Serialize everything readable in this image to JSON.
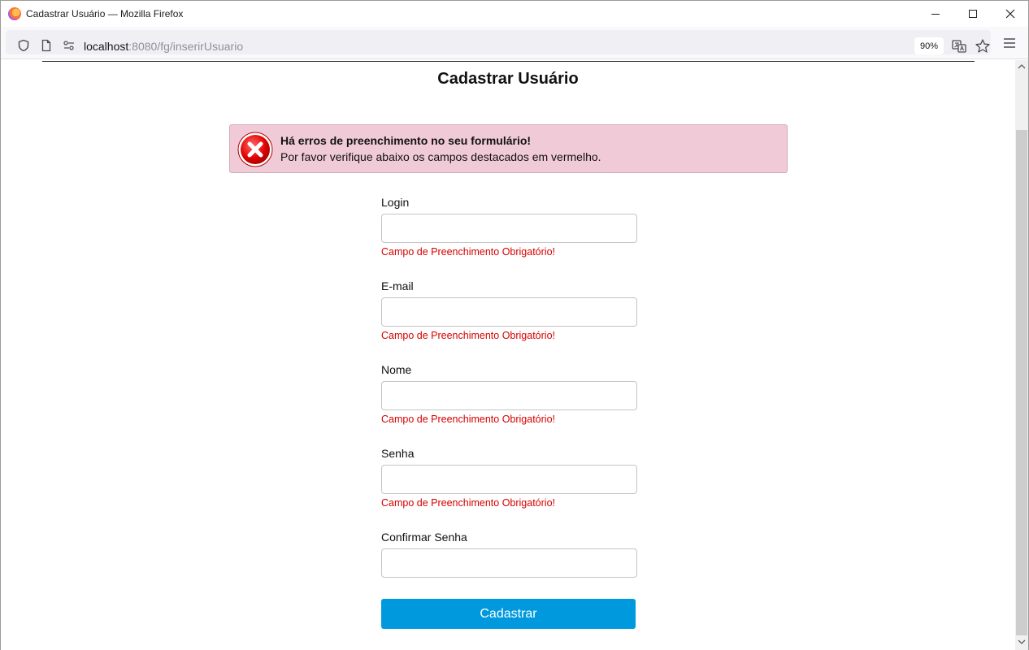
{
  "window": {
    "title": "Cadastrar Usuário — Mozilla Firefox"
  },
  "navbar": {
    "url_host": "localhost",
    "url_rest": ":8080/fg/inserirUsuario",
    "zoom": "90%"
  },
  "page": {
    "title": "Cadastrar Usuário"
  },
  "alert": {
    "title": "Há erros de preenchimento no seu formulário!",
    "message": "Por favor verifique abaixo os campos destacados em vermelho."
  },
  "form": {
    "fields": [
      {
        "label": "Login",
        "value": "",
        "error": "Campo de Preenchimento Obrigatório!"
      },
      {
        "label": "E-mail",
        "value": "",
        "error": "Campo de Preenchimento Obrigatório!"
      },
      {
        "label": "Nome",
        "value": "",
        "error": "Campo de Preenchimento Obrigatório!"
      },
      {
        "label": "Senha",
        "value": "",
        "error": "Campo de Preenchimento Obrigatório!"
      },
      {
        "label": "Confirmar Senha",
        "value": "",
        "error": ""
      }
    ],
    "submit_label": "Cadastrar"
  },
  "colors": {
    "alert_bg": "#f0cbd7",
    "error_text": "#d60000",
    "button_bg": "#0099dd"
  },
  "icons": {
    "browser": "firefox-logo-icon",
    "error": "error-x-icon"
  }
}
